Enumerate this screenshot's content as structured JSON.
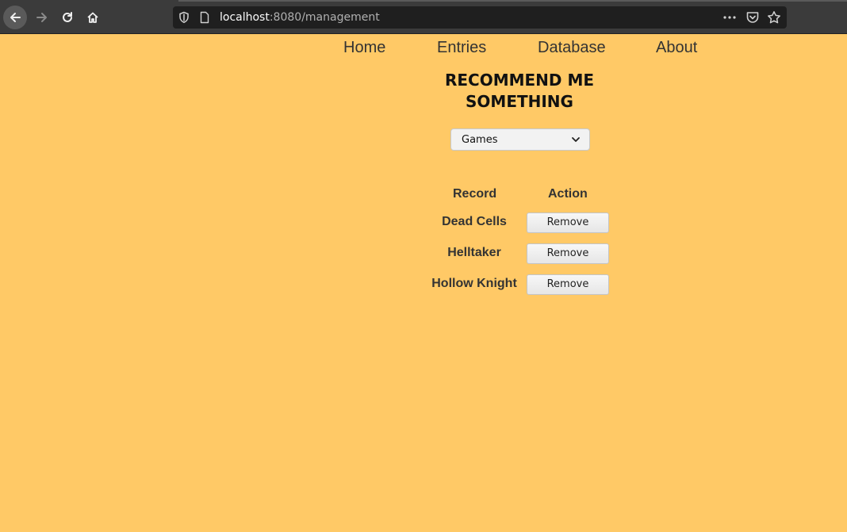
{
  "browser": {
    "url_host": "localhost",
    "url_rest": ":8080/management"
  },
  "nav": {
    "home": "Home",
    "entries": "Entries",
    "database": "Database",
    "about": "About"
  },
  "page": {
    "title": "RECOMMEND ME SOMETHING"
  },
  "category_select": {
    "selected": "Games"
  },
  "table": {
    "headers": [
      "Record",
      "Action"
    ],
    "rows": [
      {
        "record": "Dead Cells",
        "action": "Remove"
      },
      {
        "record": "Helltaker",
        "action": "Remove"
      },
      {
        "record": "Hollow Knight",
        "action": "Remove"
      }
    ]
  },
  "colors": {
    "page_background": "#FFC966",
    "nav_text": "#333333",
    "title_text": "#111111"
  },
  "icons": {
    "back": "arrow-left-icon",
    "forward": "arrow-right-icon",
    "reload": "reload-icon",
    "home": "home-icon",
    "tracking": "shield-icon",
    "page": "page-icon",
    "more": "more-dots-icon",
    "pocket": "pocket-icon",
    "bookmark": "star-icon",
    "dropdown": "chevron-down-icon"
  }
}
